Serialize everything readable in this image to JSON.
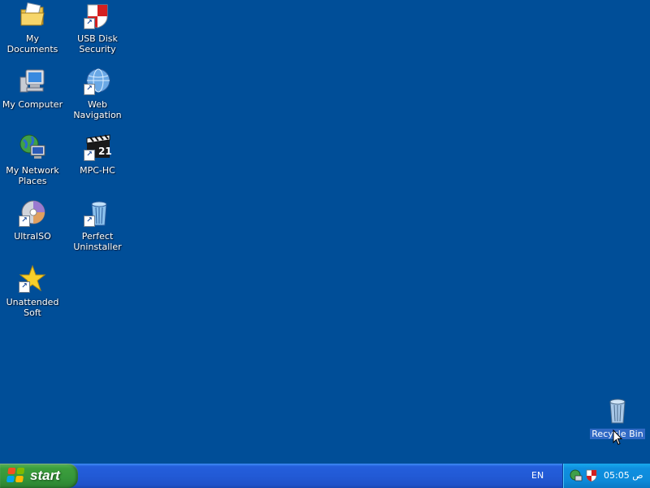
{
  "desktop": {
    "icons": [
      {
        "label": "My Documents",
        "icon": "my-documents-icon"
      },
      {
        "label": "USB Disk Security",
        "icon": "usb-disk-security-icon"
      },
      {
        "label": "My Computer",
        "icon": "my-computer-icon"
      },
      {
        "label": "Web Navigation",
        "icon": "web-navigation-icon"
      },
      {
        "label": "My Network Places",
        "icon": "network-places-icon"
      },
      {
        "label": "MPC-HC",
        "icon": "mpc-hc-icon"
      },
      {
        "label": "UltraISO",
        "icon": "ultraiso-icon"
      },
      {
        "label": "Perfect Uninstaller",
        "icon": "perfect-uninstaller-icon"
      },
      {
        "label": "Unattended Soft",
        "icon": "unattended-soft-icon"
      },
      {
        "label": "Recycle Bin",
        "icon": "recycle-bin-icon"
      }
    ]
  },
  "taskbar": {
    "start_label": "start",
    "language": "EN",
    "clock": "05:05 ص"
  },
  "colors": {
    "desktop_bg": "#004e98",
    "taskbar_blue": "#245edb",
    "start_green": "#3c9e3c",
    "tray_blue": "#0f8fe0",
    "selection": "#316ac5"
  }
}
